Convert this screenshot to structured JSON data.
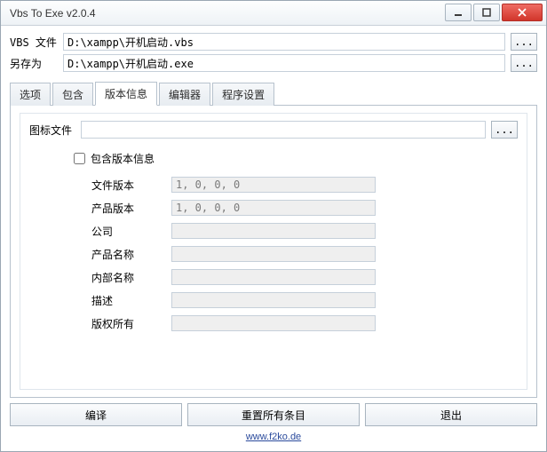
{
  "title": "Vbs To Exe v2.0.4",
  "top": {
    "vbs_label": "VBS 文件",
    "vbs_path": "D:\\xampp\\开机启动.vbs",
    "saveas_label": "另存为",
    "saveas_path": "D:\\xampp\\开机启动.exe",
    "browse": "..."
  },
  "tabs": [
    "选项",
    "包含",
    "版本信息",
    "编辑器",
    "程序设置"
  ],
  "active_tab_index": 2,
  "version_panel": {
    "icon_label": "图标文件",
    "icon_path": "",
    "include_label": "包含版本信息",
    "include_checked": false,
    "fields": [
      {
        "label": "文件版本",
        "value": "1, 0, 0, 0"
      },
      {
        "label": "产品版本",
        "value": "1, 0, 0, 0"
      },
      {
        "label": "公司",
        "value": ""
      },
      {
        "label": "产品名称",
        "value": ""
      },
      {
        "label": "内部名称",
        "value": ""
      },
      {
        "label": "描述",
        "value": ""
      },
      {
        "label": "版权所有",
        "value": ""
      }
    ]
  },
  "buttons": {
    "compile": "编译",
    "reset": "重置所有条目",
    "exit": "退出"
  },
  "footer_link": "www.f2ko.de"
}
